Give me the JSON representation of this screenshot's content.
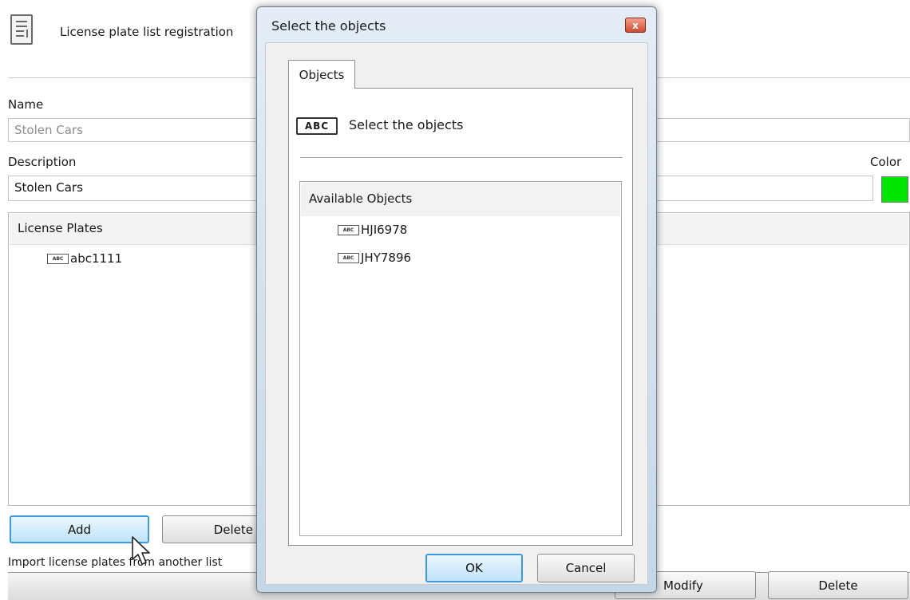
{
  "header": {
    "title": "License plate list registration",
    "icon": "document-icon"
  },
  "form": {
    "name_label": "Name",
    "name_value": "Stolen Cars",
    "description_label": "Description",
    "description_value": "Stolen Cars",
    "color_label": "Color",
    "color_value": "#00e600"
  },
  "plates": {
    "header": "License Plates",
    "items": [
      {
        "tag": "ABC",
        "value": "abc1111"
      }
    ]
  },
  "buttons": {
    "add": "Add",
    "delete": "Delete",
    "modify": "Modify",
    "delete2": "Delete"
  },
  "import_label": "Import license plates from another list",
  "dialog": {
    "title": "Select the objects",
    "close_glyph": "x",
    "tab_label": "Objects",
    "tag_text": "ABC",
    "select_label": "Select the objects",
    "available_header": "Available Objects",
    "objects": [
      {
        "tag": "ABC",
        "value": "HJI6978"
      },
      {
        "tag": "ABC",
        "value": "JHY7896"
      }
    ],
    "ok": "OK",
    "cancel": "Cancel"
  }
}
